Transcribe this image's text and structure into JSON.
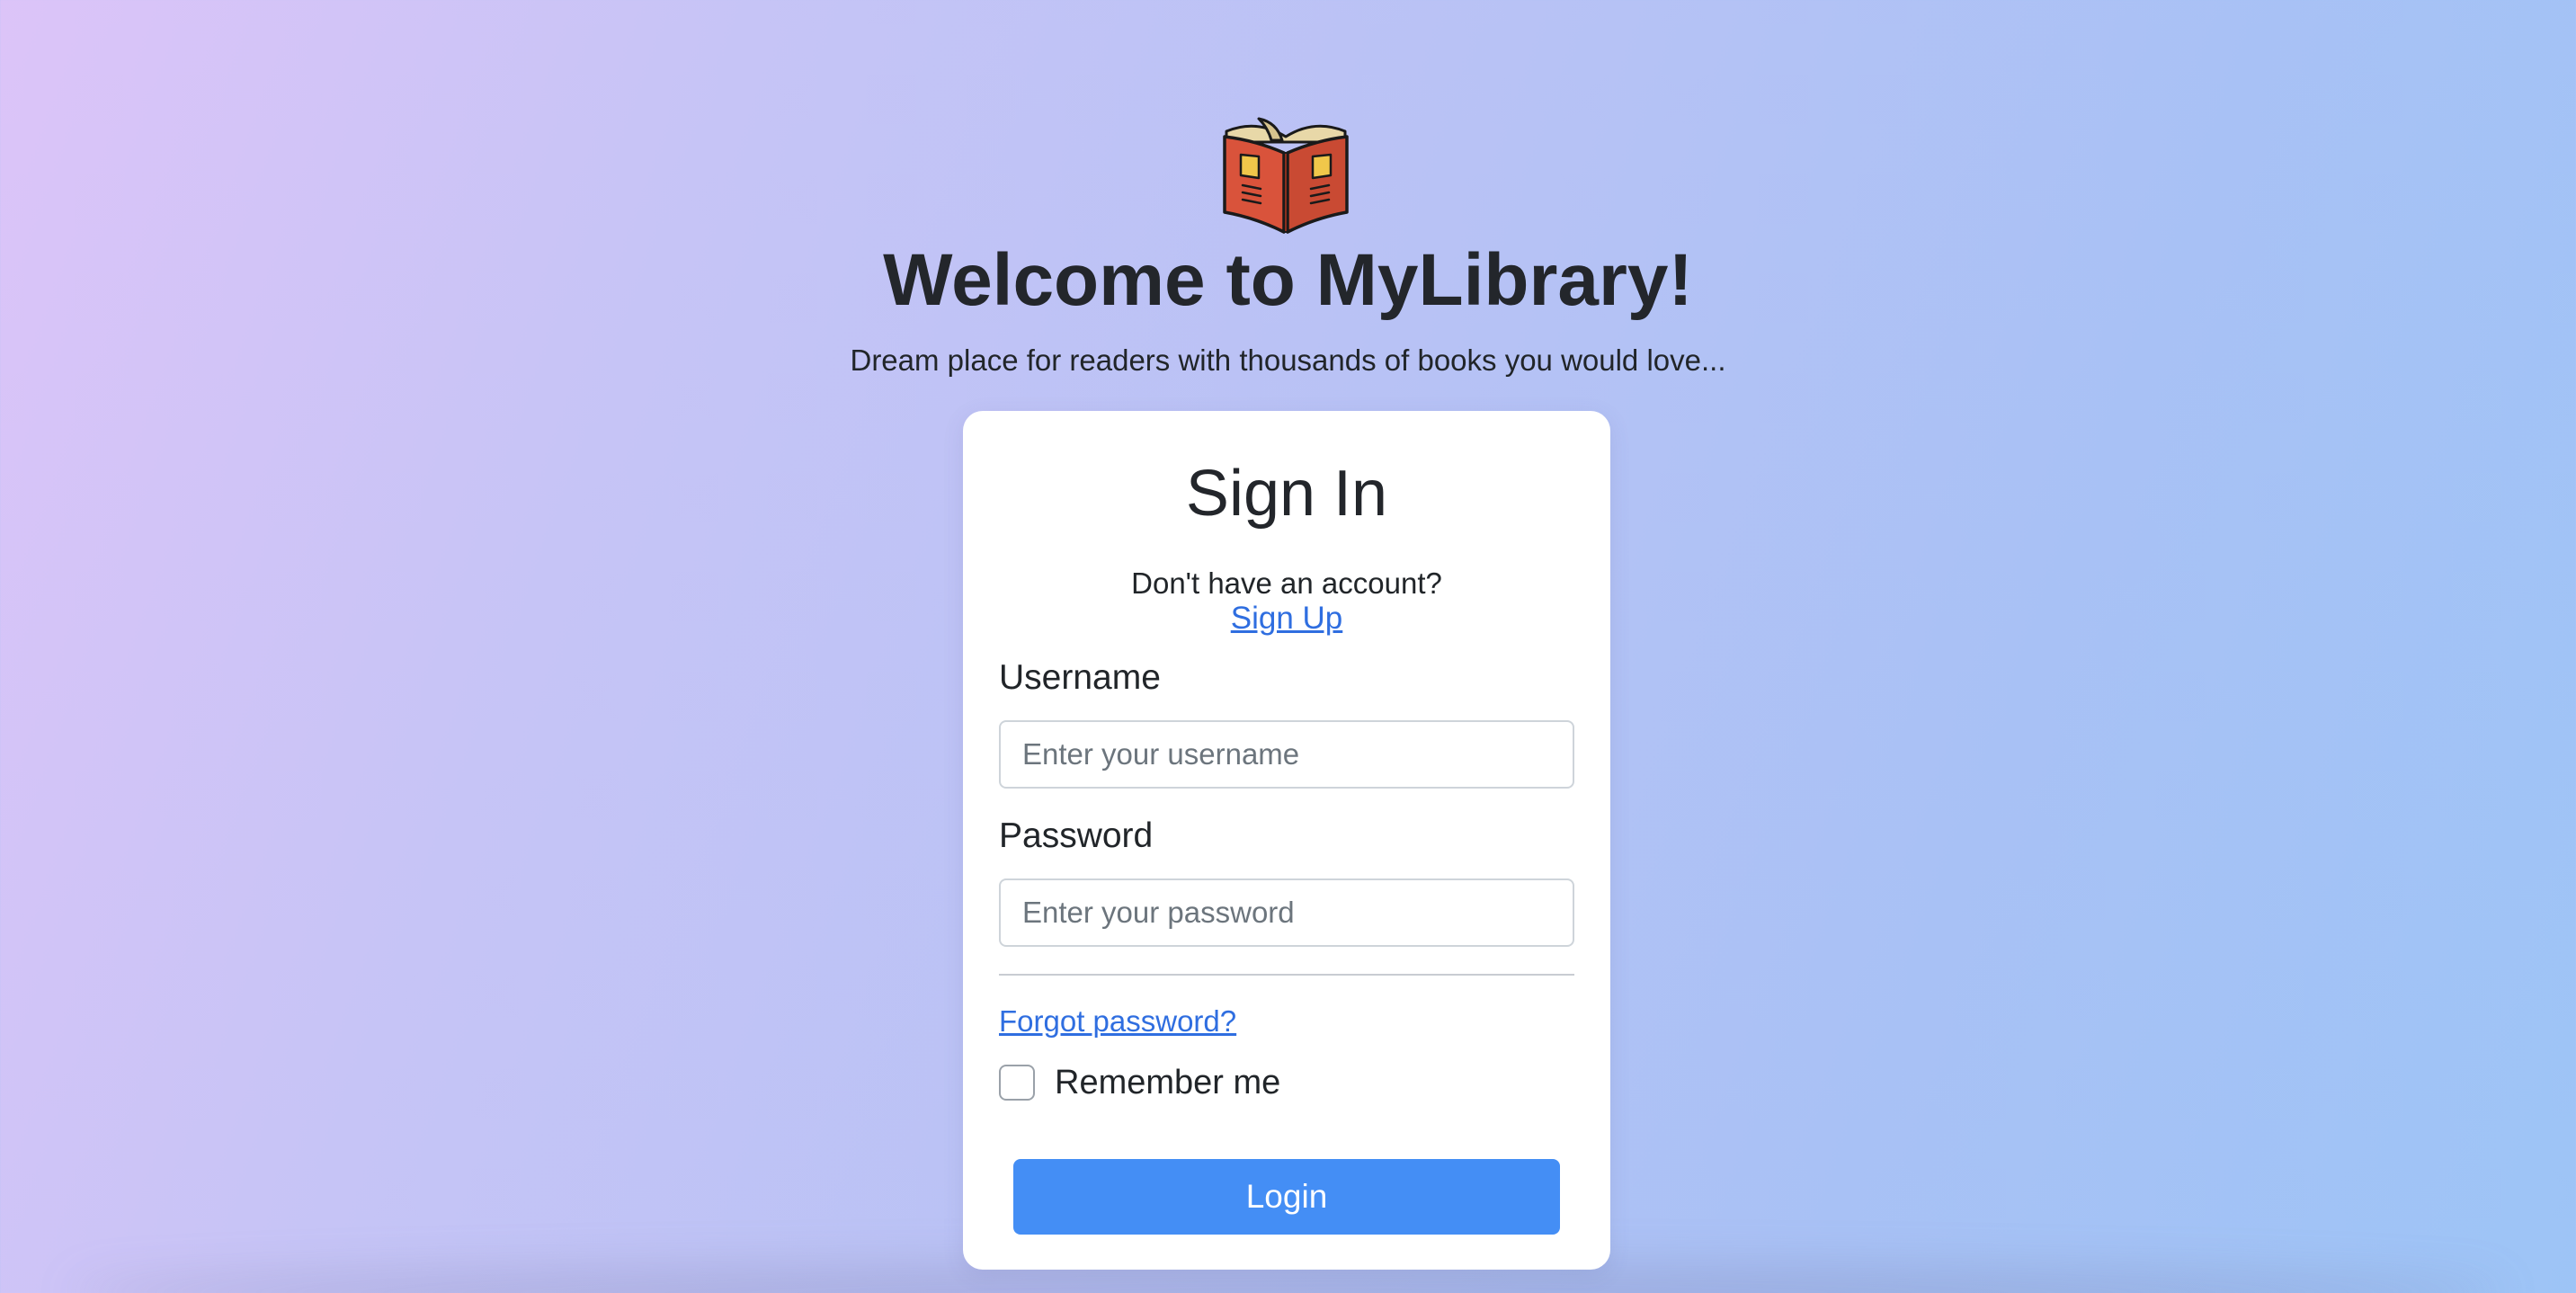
{
  "header": {
    "logo_icon": "open-book-icon",
    "title": "Welcome to MyLibrary!",
    "subtitle": "Dream place for readers with thousands of books you would love..."
  },
  "signin_card": {
    "title": "Sign In",
    "no_account_text": "Don't have an account?",
    "signup_link": "Sign Up",
    "username": {
      "label": "Username",
      "placeholder": "Enter your username",
      "value": ""
    },
    "password": {
      "label": "Password",
      "placeholder": "Enter your password",
      "value": ""
    },
    "forgot_password_link": "Forgot password?",
    "remember_me": {
      "label": "Remember me",
      "checked": false
    },
    "login_button": "Login"
  },
  "colors": {
    "background_start": "#dcc4f8",
    "background_end": "#9dc4f6",
    "link": "#2f6ee0",
    "primary_button": "#448ef5",
    "book_cover": "#d9533b",
    "book_pages": "#e8d8a8"
  }
}
